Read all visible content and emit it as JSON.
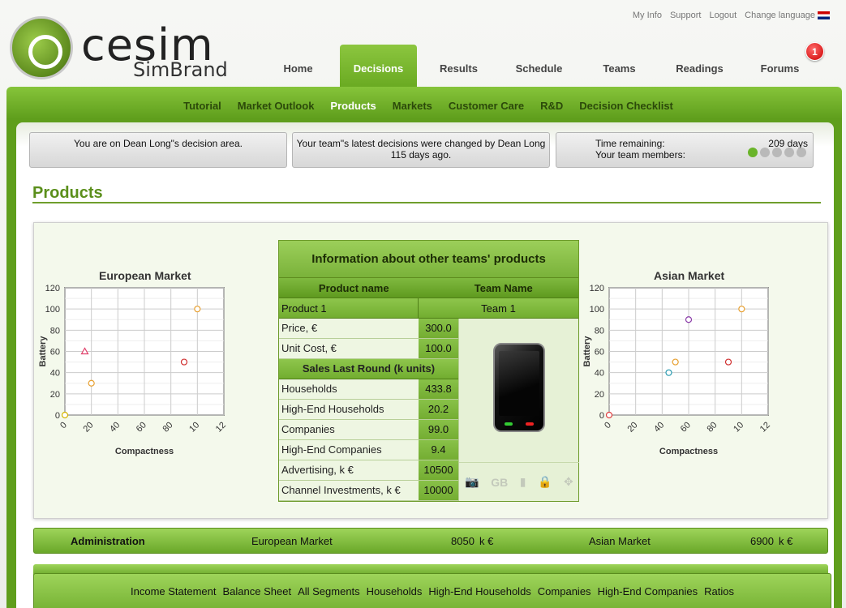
{
  "logo": {
    "word": "cesim",
    "sub": "SimBrand"
  },
  "toplinks": [
    "My Info",
    "Support",
    "Logout",
    "Change language"
  ],
  "mainnav": [
    "Home",
    "Decisions",
    "Results",
    "Schedule",
    "Teams",
    "Readings",
    "Forums"
  ],
  "forums_badge": "1",
  "subnav": [
    "Tutorial",
    "Market Outlook",
    "Products",
    "Markets",
    "Customer Care",
    "R&D",
    "Decision Checklist"
  ],
  "status": {
    "decision_area": "You are on Dean Long\"s decision area.",
    "latest_change_line1": "Your team\"s latest decisions were changed by Dean Long",
    "latest_change_line2": "115 days ago.",
    "time_remaining_label": "Time remaining:",
    "time_remaining_value": "209 days",
    "members_label": "Your team members:"
  },
  "page_title": "Products",
  "info_table": {
    "heading": "Information about other teams' products",
    "col_product": "Product name",
    "col_team": "Team Name",
    "product": "Product 1",
    "team": "Team 1",
    "price_label": "Price, €",
    "price": "300.0",
    "unit_cost_label": "Unit Cost, €",
    "unit_cost": "100.0",
    "sales_heading": "Sales Last Round (k units)",
    "households_label": "Households",
    "households": "433.8",
    "he_households_label": "High-End Households",
    "he_households": "20.2",
    "companies_label": "Companies",
    "companies": "99.0",
    "he_companies_label": "High-End Companies",
    "he_companies": "9.4",
    "advertising_label": "Advertising, k €",
    "advertising": "10500",
    "channel_label": "Channel Investments, k €",
    "channel": "10000"
  },
  "admin": {
    "label": "Administration",
    "eu_label": "European Market",
    "eu_value": "8050",
    "as_label": "Asian Market",
    "as_value": "6900",
    "unit": "k €"
  },
  "reports": [
    "Income Statement",
    "Balance Sheet",
    "All Segments",
    "Households",
    "High-End Households",
    "Companies",
    "High-End Companies",
    "Ratios"
  ],
  "chart_data": [
    {
      "type": "scatter",
      "title": "European Market",
      "xlabel": "Compactness",
      "ylabel": "Battery",
      "xticks": [
        "0",
        "20",
        "40",
        "60",
        "80",
        "10",
        "12"
      ],
      "yticks": [
        "0",
        "20",
        "40",
        "60",
        "80",
        "100",
        "120"
      ],
      "ylim": [
        0,
        120
      ],
      "grid": true,
      "points": [
        {
          "x": 0,
          "y": 0,
          "color": "#d4b400",
          "marker": "circle"
        },
        {
          "x": 20,
          "y": 30,
          "color": "#e8a030",
          "marker": "circle"
        },
        {
          "x": 15,
          "y": 60,
          "color": "#e0406a",
          "marker": "triangle"
        },
        {
          "x": 90,
          "y": 50,
          "color": "#d03030",
          "marker": "circle"
        },
        {
          "x": 100,
          "y": 100,
          "color": "#e8a030",
          "marker": "circle"
        }
      ]
    },
    {
      "type": "scatter",
      "title": "Asian Market",
      "xlabel": "Compactness",
      "ylabel": "Battery",
      "xticks": [
        "0",
        "20",
        "40",
        "60",
        "80",
        "10",
        "12"
      ],
      "yticks": [
        "0",
        "20",
        "40",
        "60",
        "80",
        "100",
        "120"
      ],
      "ylim": [
        0,
        120
      ],
      "grid": true,
      "points": [
        {
          "x": 0,
          "y": 0,
          "color": "#e04040",
          "marker": "circle"
        },
        {
          "x": 45,
          "y": 40,
          "color": "#2a9ab0",
          "marker": "circle"
        },
        {
          "x": 50,
          "y": 50,
          "color": "#e8a030",
          "marker": "circle"
        },
        {
          "x": 60,
          "y": 90,
          "color": "#8a3aa8",
          "marker": "circle"
        },
        {
          "x": 90,
          "y": 50,
          "color": "#d03030",
          "marker": "circle"
        },
        {
          "x": 100,
          "y": 100,
          "color": "#e8a030",
          "marker": "circle"
        }
      ]
    }
  ]
}
